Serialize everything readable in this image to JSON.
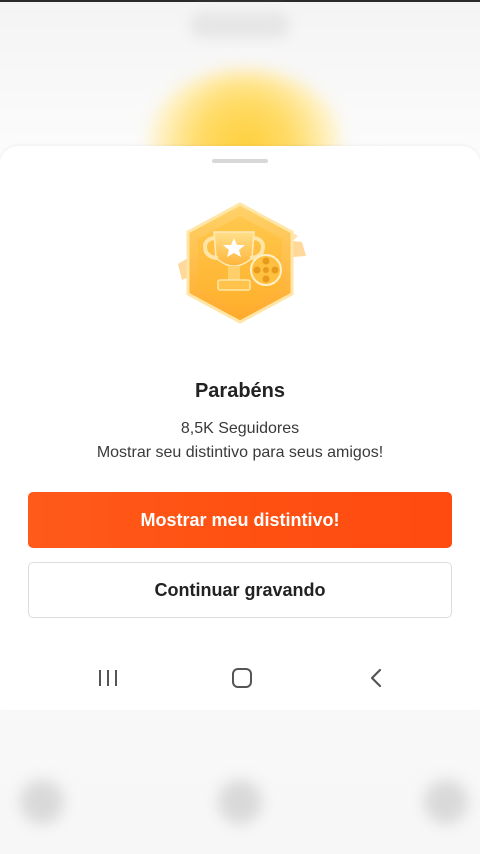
{
  "dialog": {
    "title": "Parabéns",
    "followers": "8,5K Seguidores",
    "prompt": "Mostrar seu distintivo para seus amigos!",
    "primary_button": "Mostrar meu distintivo!",
    "secondary_button": "Continuar gravando",
    "badge_icon": "trophy-film-reel-badge-icon"
  },
  "navbar": {
    "recents_icon": "recents-icon",
    "home_icon": "home-icon",
    "back_icon": "back-icon"
  },
  "colors": {
    "primary": "#ff5112",
    "badge_gold": "#ffb43a",
    "text": "#222222"
  }
}
